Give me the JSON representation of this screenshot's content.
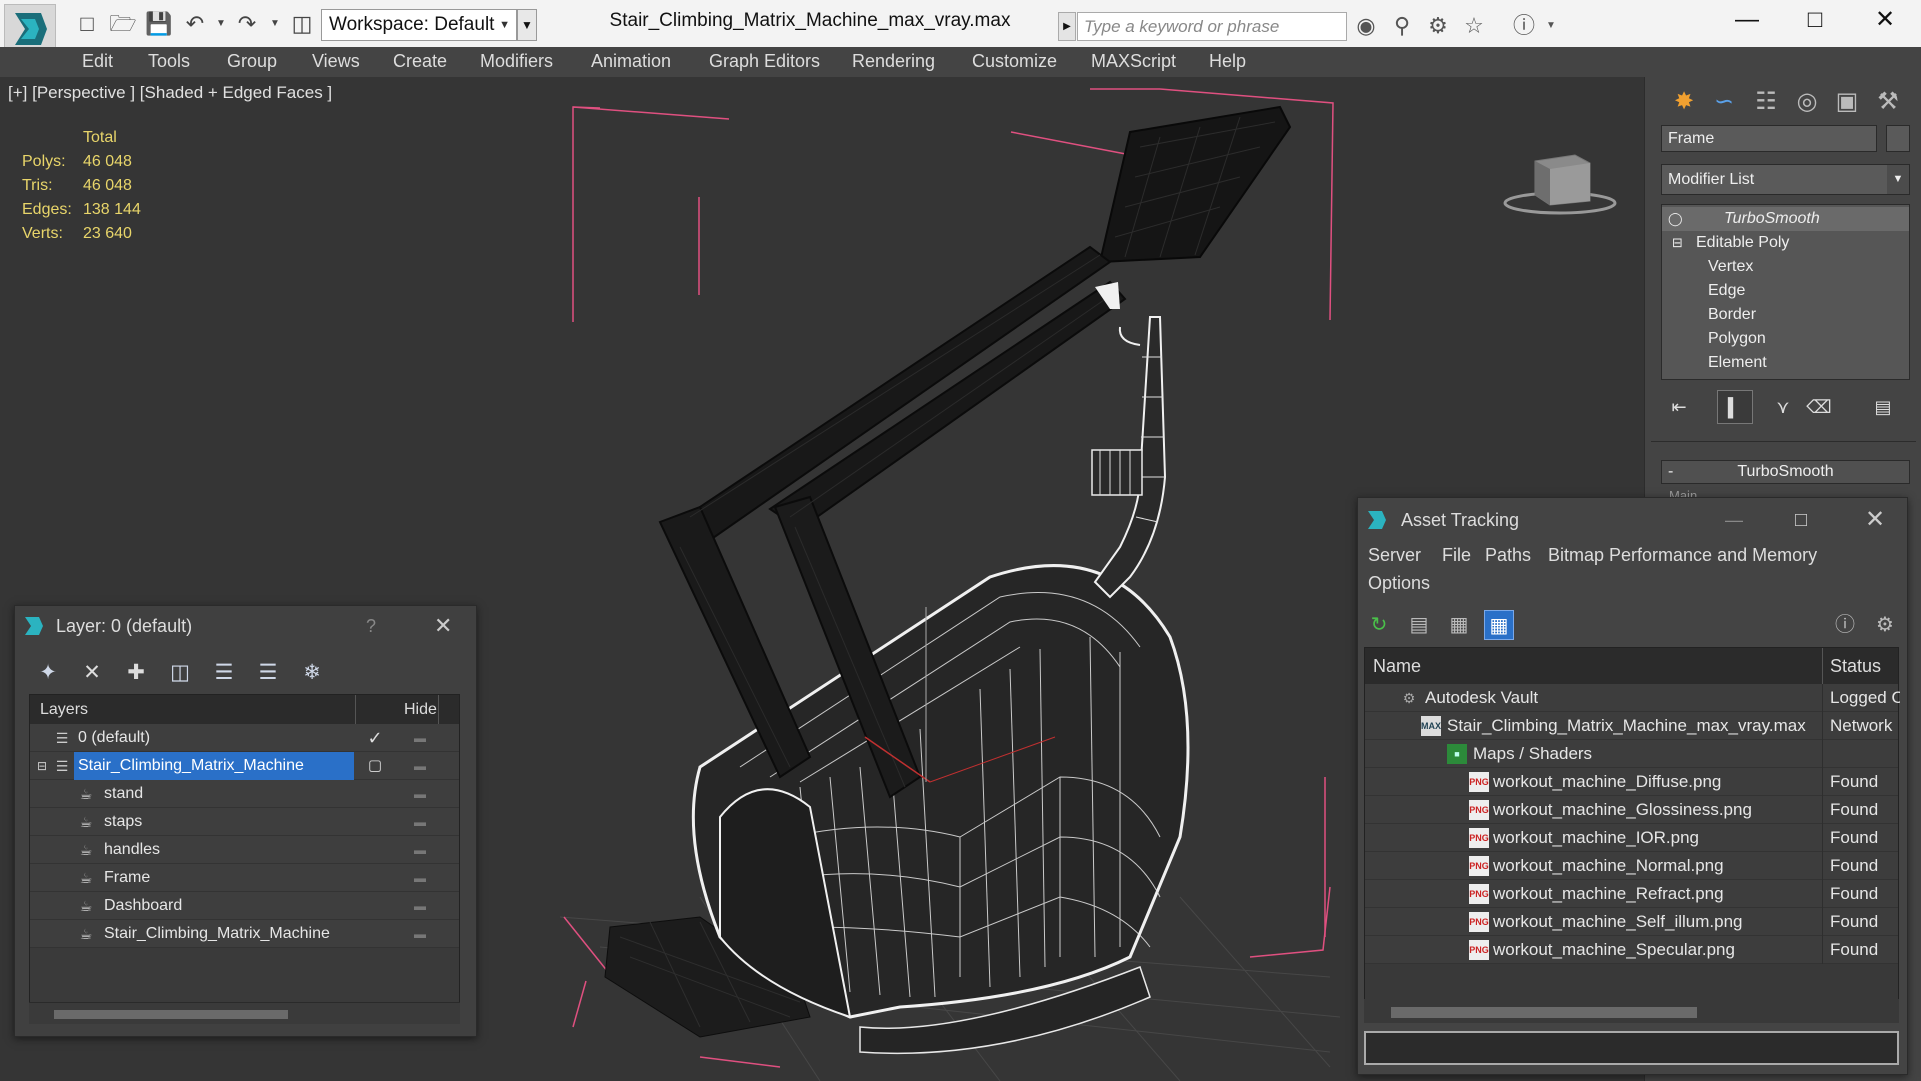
{
  "titlebar": {
    "workspace": "Workspace: Default",
    "doc_title": "Stair_Climbing_Matrix_Machine_max_vray.max",
    "search_placeholder": "Type a keyword or phrase"
  },
  "menu": [
    "Edit",
    "Tools",
    "Group",
    "Views",
    "Create",
    "Modifiers",
    "Animation",
    "Graph Editors",
    "Rendering",
    "Customize",
    "MAXScript",
    "Help"
  ],
  "viewport": {
    "label": "[+] [Perspective ] [Shaded + Edged Faces ]",
    "stats_header": "Total",
    "stats": [
      {
        "key": "Polys:",
        "value": "46 048"
      },
      {
        "key": "Tris:",
        "value": "46 048"
      },
      {
        "key": "Edges:",
        "value": "138 144"
      },
      {
        "key": "Verts:",
        "value": "23 640"
      }
    ]
  },
  "command_panel": {
    "object_name": "Frame",
    "modifier_list": "Modifier List",
    "stack": [
      "TurboSmooth",
      "Editable Poly",
      "Vertex",
      "Edge",
      "Border",
      "Polygon",
      "Element"
    ],
    "rollout": "TurboSmooth",
    "rollout_sub": "Main"
  },
  "layer_window": {
    "title": "Layer: 0 (default)",
    "help": "?",
    "col_layers": "Layers",
    "col_hide": "Hide",
    "rows": [
      {
        "name": "0 (default)"
      },
      {
        "name": "Stair_Climbing_Matrix_Machine"
      },
      {
        "name": "stand"
      },
      {
        "name": "staps"
      },
      {
        "name": "handles"
      },
      {
        "name": "Frame"
      },
      {
        "name": "Dashboard"
      },
      {
        "name": "Stair_Climbing_Matrix_Machine"
      }
    ]
  },
  "asset_window": {
    "title": "Asset Tracking",
    "menu": [
      "Server",
      "File",
      "Paths",
      "Bitmap Performance and Memory",
      "Options"
    ],
    "col_name": "Name",
    "col_status": "Status",
    "rows": [
      {
        "name": "Autodesk Vault",
        "status": "Logged O"
      },
      {
        "name": "Stair_Climbing_Matrix_Machine_max_vray.max",
        "status": "Network"
      },
      {
        "name": "Maps / Shaders",
        "status": ""
      },
      {
        "name": "workout_machine_Diffuse.png",
        "status": "Found"
      },
      {
        "name": "workout_machine_Glossiness.png",
        "status": "Found"
      },
      {
        "name": "workout_machine_IOR.png",
        "status": "Found"
      },
      {
        "name": "workout_machine_Normal.png",
        "status": "Found"
      },
      {
        "name": "workout_machine_Refract.png",
        "status": "Found"
      },
      {
        "name": "workout_machine_Self_illum.png",
        "status": "Found"
      },
      {
        "name": "workout_machine_Specular.png",
        "status": "Found"
      }
    ]
  },
  "colors": {
    "selection_blue": "#2a70c8",
    "stats_yellow": "#e8d56a",
    "bbox_pink": "#e05080"
  }
}
